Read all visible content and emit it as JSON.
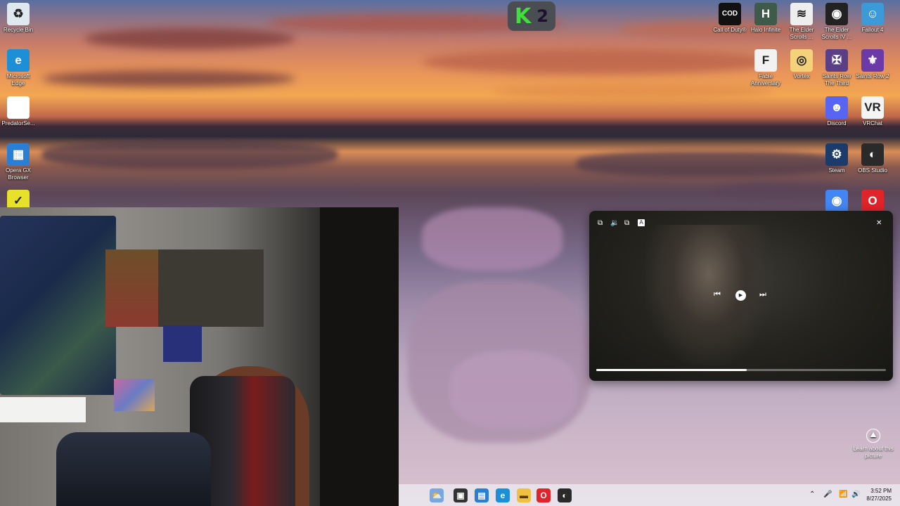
{
  "desktop_left": [
    {
      "label": "Recycle Bin",
      "icon": "recycle-bin-icon",
      "glyph": "♻",
      "color": "#dfe8ee"
    },
    {
      "label": "Microsoft Edge",
      "icon": "edge-icon",
      "glyph": "e",
      "color": "#1c8fd6"
    },
    {
      "label": "PredatorSe...",
      "icon": "document-icon",
      "glyph": "",
      "color": "#ffffff"
    },
    {
      "label": "Opera GX Browser",
      "icon": "opera-gx-icon",
      "glyph": "▦",
      "color": "#2a7fd4"
    },
    {
      "label": "",
      "icon": "checkmark-app-icon",
      "glyph": "✓",
      "color": "#e7e12a"
    }
  ],
  "desktop_right": [
    {
      "label": "Call of Duty®",
      "icon": "call-of-duty-icon",
      "glyph": "COD",
      "color": "#111111"
    },
    {
      "label": "Halo Infinite",
      "icon": "halo-infinite-icon",
      "glyph": "H",
      "color": "#3d5a4a"
    },
    {
      "label": "The Elder Scrolls ...",
      "icon": "elder-scrolls-icon",
      "glyph": "≋",
      "color": "#eeeeee"
    },
    {
      "label": "The Elder Scrolls IV ...",
      "icon": "oblivion-icon",
      "glyph": "◉",
      "color": "#222222"
    },
    {
      "label": "Fallout 4",
      "icon": "fallout-4-icon",
      "glyph": "☺",
      "color": "#3d9ad9"
    },
    {
      "label": "Fable Anniversary",
      "icon": "fable-anniversary-icon",
      "glyph": "F",
      "color": "#f2f2f2"
    },
    {
      "label": "Vortex",
      "icon": "vortex-icon",
      "glyph": "◎",
      "color": "#f4d27a"
    },
    {
      "label": "Saints Row The Third",
      "icon": "saints-row-third-icon",
      "glyph": "✠",
      "color": "#5a3f86"
    },
    {
      "label": "Saints Row 2",
      "icon": "saints-row-2-icon",
      "glyph": "⚜",
      "color": "#6c3aa6"
    },
    {
      "label": "Discord",
      "icon": "discord-icon",
      "glyph": "☻",
      "color": "#5865f2"
    },
    {
      "label": "VRChat",
      "icon": "vrchat-icon",
      "glyph": "VR",
      "color": "#f4f4f4"
    },
    {
      "label": "Steam",
      "icon": "steam-icon",
      "glyph": "⚙",
      "color": "#1b3b6a"
    },
    {
      "label": "OBS Studio",
      "icon": "obs-studio-icon",
      "glyph": "◐",
      "color": "#2a2a2a"
    },
    {
      "label": "",
      "icon": "chrome-icon",
      "glyph": "◉",
      "color": "#4285f4"
    },
    {
      "label": "",
      "icon": "opera-icon",
      "glyph": "O",
      "color": "#e0242a"
    }
  ],
  "overlay": {
    "k": "K",
    "n": "2"
  },
  "player": {
    "controls_top": [
      "⧉",
      "🔉",
      "⧉",
      "A"
    ],
    "close": "✕",
    "prev": "⏮",
    "play": "▶",
    "next": "⏭",
    "progress": 0.52
  },
  "learn": {
    "label": "Learn about this picture",
    "glyph": "⛰"
  },
  "taskbar": {
    "apps": [
      {
        "icon": "widgets-icon",
        "glyph": "⛅",
        "color": "#7aa7e0"
      },
      {
        "icon": "task-view-icon",
        "glyph": "▣",
        "color": "#333333"
      },
      {
        "icon": "store-icon",
        "glyph": "▤",
        "color": "#2a7fd4"
      },
      {
        "icon": "edge-taskbar-icon",
        "glyph": "e",
        "color": "#1c8fd6"
      },
      {
        "icon": "file-explorer-icon",
        "glyph": "▬",
        "color": "#f0c040"
      },
      {
        "icon": "opera-taskbar-icon",
        "glyph": "O",
        "color": "#e0242a"
      },
      {
        "icon": "obs-taskbar-icon",
        "glyph": "◐",
        "color": "#2a2a2a"
      }
    ],
    "tray": [
      "⌃",
      "🎤",
      "📶",
      "🔊"
    ],
    "time": "3:52 PM",
    "date": "8/27/2025"
  }
}
